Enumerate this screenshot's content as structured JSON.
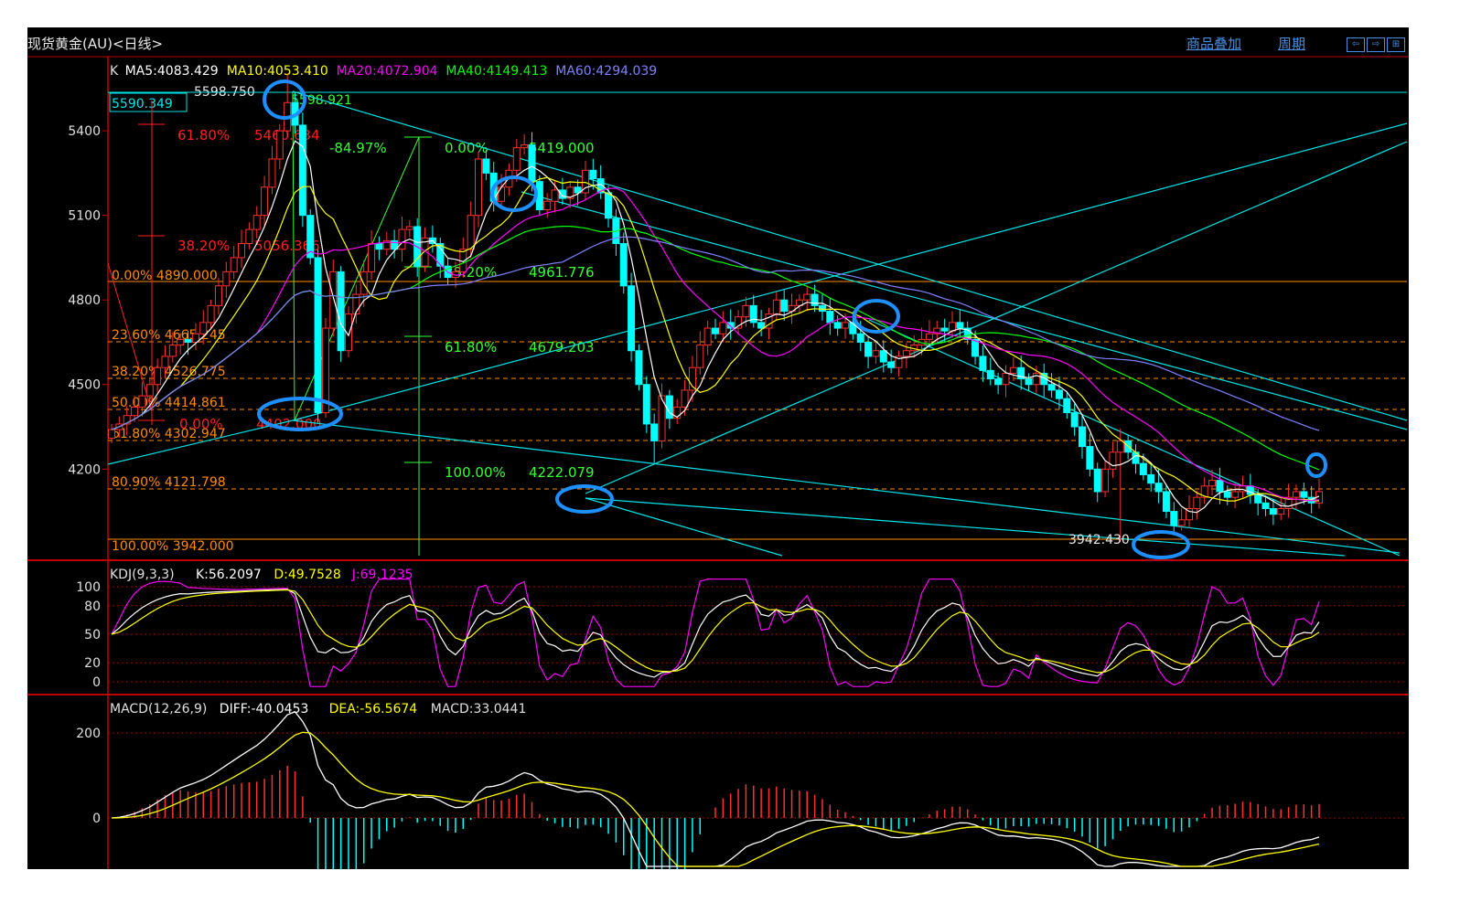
{
  "window": {
    "title": "现货黄金(AU)<日线>",
    "link_overlay": "商品叠加",
    "link_period": "周期",
    "buttons": [
      "⇦",
      "⇨",
      "⊞"
    ]
  },
  "colors": {
    "background": "#000000",
    "up": "#ff3030",
    "down": "#00ffff",
    "ma5": "#ffffff",
    "ma10": "#ffff00",
    "ma20": "#ff00ff",
    "ma40": "#00ff00",
    "ma60": "#8080ff",
    "fib_orange": "#ff8c00",
    "fib_red": "#ff2020",
    "fib_green": "#33ff33",
    "trendline": "#00e5e5",
    "circle": "#1e8fff",
    "axis_text": "#e0e0e0"
  },
  "main": {
    "legend": [
      {
        "label": "K",
        "color": "#e0e0e0"
      },
      {
        "label": "MA5:4083.429",
        "color": "#ffffff"
      },
      {
        "label": "MA10:4053.410",
        "color": "#ffff00"
      },
      {
        "label": "MA20:4072.904",
        "color": "#ff00ff"
      },
      {
        "label": "MA40:4149.413",
        "color": "#00ff00"
      },
      {
        "label": "MA60:4294.039",
        "color": "#8080ff"
      }
    ],
    "y_ticks": [
      "5400",
      "5100",
      "4800",
      "4500",
      "4200"
    ],
    "price_box": "5590.349",
    "high_label": "5598.750",
    "high_label2": "5598.921",
    "low_label": "3942.430",
    "fib_left": [
      "0.00% 4890.000",
      "23.60% 4665.245",
      "38.20% 4526.775",
      "50.00% 4414.861",
      "61.80% 4302.947",
      "80.90% 4121.798",
      "100.00% 3942.000"
    ],
    "fib_red": [
      {
        "pct": "61.80%",
        "val": "5460.634"
      },
      {
        "pct": "38.20%",
        "val": "5056.366"
      },
      {
        "pct": "0.00%",
        "val": "4402.000"
      }
    ],
    "fib_green": [
      {
        "pct": "0.00%",
        "val": "5419.000"
      },
      {
        "pct": "38.20%",
        "val": "4961.776"
      },
      {
        "pct": "61.80%",
        "val": "4679.203"
      },
      {
        "pct": "100.00%",
        "val": "4222.079"
      }
    ],
    "green_pct": "-84.97%"
  },
  "kdj": {
    "legend": [
      {
        "label": "KDJ(9,3,3)",
        "color": "#e0e0e0"
      },
      {
        "label": "K:56.2097",
        "color": "#ffffff"
      },
      {
        "label": "D:49.7528",
        "color": "#ffff00"
      },
      {
        "label": "J:69.1235",
        "color": "#ff00ff"
      }
    ],
    "y_ticks": [
      "100",
      "80",
      "50",
      "20",
      "0"
    ]
  },
  "macd": {
    "legend": [
      {
        "label": "MACD(12,26,9)",
        "color": "#e0e0e0"
      },
      {
        "label": "DIFF:-40.0453",
        "color": "#ffffff"
      },
      {
        "label": "DEA:-56.5674",
        "color": "#ffff00"
      },
      {
        "label": "MACD:33.0441",
        "color": "#e0e0e0"
      }
    ],
    "y_ticks": [
      "200",
      "0"
    ]
  },
  "chart_data": {
    "type": "candlestick",
    "title": "现货黄金(AU)<日线>",
    "xlabel": "",
    "ylabel": "",
    "ylim": [
      3880,
      5650
    ],
    "grid": false,
    "closes": [
      4340,
      4360,
      4390,
      4420,
      4460,
      4500,
      4560,
      4600,
      4640,
      4660,
      4650,
      4680,
      4720,
      4780,
      4850,
      4900,
      4950,
      5000,
      5050,
      5100,
      5200,
      5300,
      5400,
      5500,
      5420,
      5100,
      4950,
      4400,
      4700,
      4900,
      4620,
      4750,
      4820,
      4900,
      5000,
      4980,
      5010,
      4980,
      5050,
      5060,
      4920,
      5020,
      5000,
      4920,
      4880,
      4900,
      4980,
      5100,
      5300,
      5250,
      5150,
      5200,
      5260,
      5340,
      5350,
      5220,
      5120,
      5150,
      5190,
      5160,
      5200,
      5180,
      5260,
      5230,
      5180,
      5090,
      5000,
      4850,
      4620,
      4500,
      4360,
      4300,
      4460,
      4380,
      4420,
      4480,
      4560,
      4640,
      4700,
      4680,
      4720,
      4700,
      4740,
      4780,
      4720,
      4700,
      4750,
      4800,
      4760,
      4780,
      4800,
      4820,
      4780,
      4760,
      4720,
      4700,
      4720,
      4680,
      4650,
      4600,
      4620,
      4580,
      4560,
      4600,
      4620,
      4640,
      4660,
      4680,
      4700,
      4690,
      4720,
      4700,
      4660,
      4600,
      4550,
      4520,
      4500,
      4540,
      4560,
      4520,
      4500,
      4540,
      4500,
      4480,
      4450,
      4400,
      4350,
      4280,
      4200,
      4120,
      4200,
      4260,
      4300,
      4260,
      4220,
      4180,
      4150,
      4120,
      4050,
      4000,
      4020,
      4060,
      4100,
      4140,
      4160,
      4120,
      4100,
      4120,
      4140,
      4110,
      4080,
      4060,
      4040,
      4060,
      4100,
      4120,
      4100,
      4080,
      4120
    ],
    "ma_latest": {
      "MA5": 4083.429,
      "MA10": 4053.41,
      "MA20": 4072.904,
      "MA40": 4149.413,
      "MA60": 4294.039
    },
    "kdj_latest": {
      "K": 56.2097,
      "D": 49.7528,
      "J": 69.1235
    },
    "macd_latest": {
      "DIFF": -40.0453,
      "DEA": -56.5674,
      "MACD": 33.0441
    }
  }
}
